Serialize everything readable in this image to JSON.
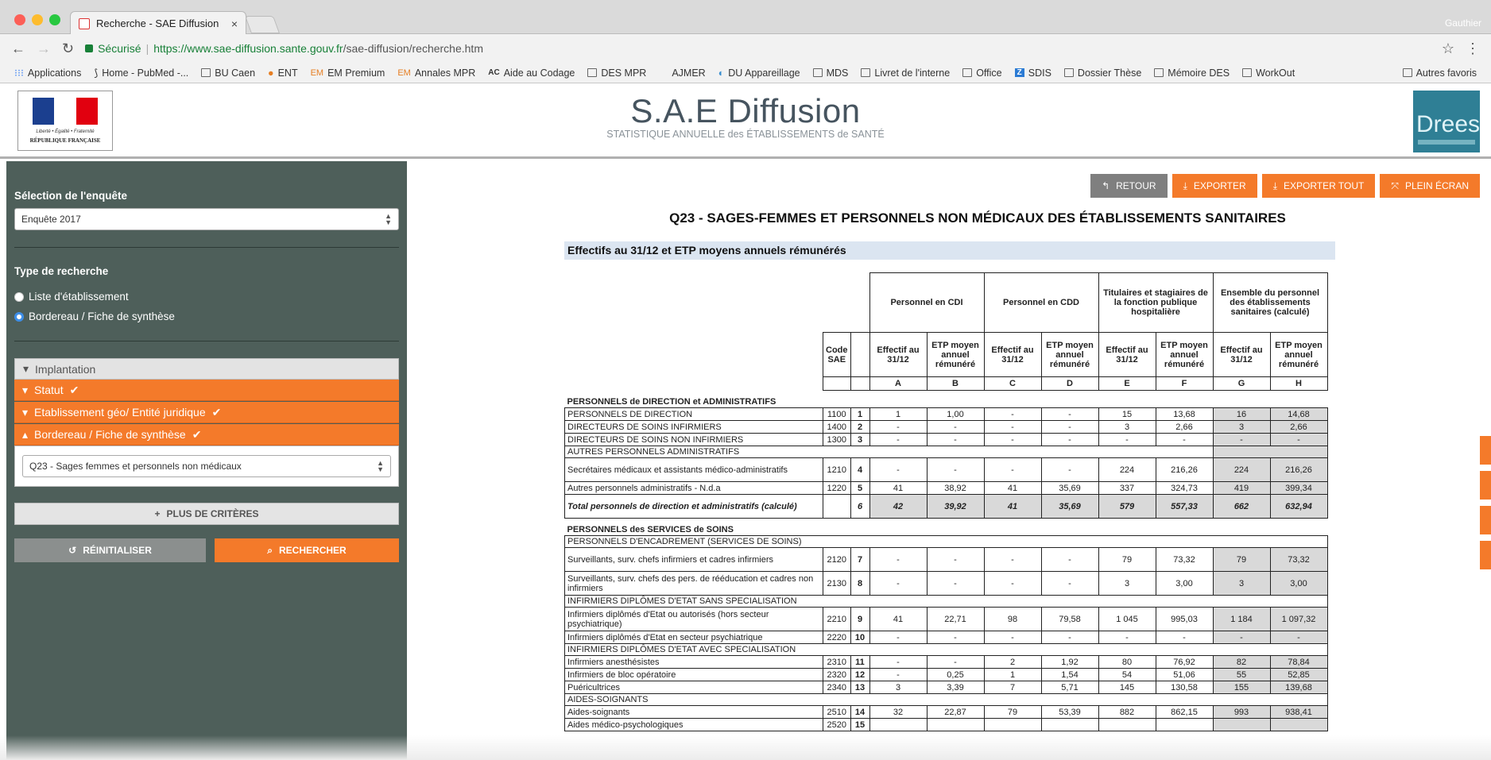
{
  "browser": {
    "tab_title": "Recherche - SAE Diffusion",
    "profile": "Gauthier",
    "secure_label": "Sécurisé",
    "url_host": "https://www.sae-diffusion.sante.gouv.fr",
    "url_path": "/sae-diffusion/recherche.htm",
    "bookmarks": [
      "Applications",
      "Home - PubMed -...",
      "BU Caen",
      "ENT",
      "EM Premium",
      "Annales MPR",
      "Aide au Codage",
      "DES MPR",
      "AJMER",
      "DU Appareillage",
      "MDS",
      "Livret de l'interne",
      "Office",
      "SDIS",
      "Dossier Thèse",
      "Mémoire DES",
      "WorkOut"
    ],
    "other_bookmarks": "Autres favoris"
  },
  "header": {
    "title": "S.A.E Diffusion",
    "subtitle": "STATISTIQUE ANNUELLE des ÉTABLISSEMENTS de SANTÉ",
    "republic_motto": "Liberté • Égalité • Fraternité",
    "republic_name": "RÉPUBLIQUE FRANÇAISE",
    "drees_logo": "Drees",
    "colors": {
      "brand_orange": "#f47a2a",
      "sidebar": "#4e5f5a"
    }
  },
  "sidebar": {
    "survey_label": "Sélection de l'enquête",
    "survey_value": "Enquête 2017",
    "search_type_label": "Type de recherche",
    "radio_1": "Liste d'établissement",
    "radio_2": "Bordereau / Fiche de synthèse",
    "acc_implantation": "Implantation",
    "acc_statut": "Statut",
    "acc_etab": "Etablissement géo/ Entité juridique",
    "acc_bordereau": "Bordereau / Fiche de synthèse",
    "bordereau_value": "Q23 - Sages femmes et personnels non médicaux",
    "more_criteria": "PLUS DE CRITÈRES",
    "reset": "RÉINITIALISER",
    "search": "RECHERCHER"
  },
  "main": {
    "btn_back": "RETOUR",
    "btn_export": "EXPORTER",
    "btn_export_all": "EXPORTER TOUT",
    "btn_fullscreen": "PLEIN ÉCRAN",
    "title": "Q23 - SAGES-FEMMES ET PERSONNELS NON MÉDICAUX DES ÉTABLISSEMENTS SANITAIRES",
    "section": "Effectifs au 31/12 et ETP moyens annuels rémunérés",
    "groups": {
      "cdi": "Personnel en CDI",
      "cdd": "Personnel en CDD",
      "tit": "Titulaires et stagiaires de la fonction publique hospitalière",
      "ens": "Ensemble du personnel des établissements sanitaires (calculé)"
    },
    "code_header": "Code SAE",
    "sub_eff": "Effectif au 31/12",
    "sub_etp": "ETP moyen annuel rémunéré",
    "letters": [
      "A",
      "B",
      "C",
      "D",
      "E",
      "F",
      "G",
      "H"
    ],
    "cat1": "PERSONNELS de DIRECTION et ADMINISTRATIFS",
    "cat2": "PERSONNELS des SERVICES de SOINS",
    "rows": [
      {
        "label": "PERSONNELS DE DIRECTION",
        "code": "1100",
        "num": "1",
        "v": [
          "1",
          "1,00",
          "-",
          "-",
          "15",
          "13,68",
          "16",
          "14,68"
        ]
      },
      {
        "label": "DIRECTEURS DE SOINS INFIRMIERS",
        "code": "1400",
        "num": "2",
        "v": [
          "-",
          "-",
          "-",
          "-",
          "3",
          "2,66",
          "3",
          "2,66"
        ]
      },
      {
        "label": "DIRECTEURS DE SOINS NON INFIRMIERS",
        "code": "1300",
        "num": "3",
        "v": [
          "-",
          "-",
          "-",
          "-",
          "-",
          "-",
          "-",
          "-"
        ]
      },
      {
        "label": "AUTRES PERSONNELS ADMINISTRATIFS"
      },
      {
        "label": "Secrétaires médicaux et assistants médico-administratifs",
        "code": "1210",
        "num": "4",
        "v": [
          "-",
          "-",
          "-",
          "-",
          "224",
          "216,26",
          "224",
          "216,26"
        ]
      },
      {
        "label": "Autres personnels administratifs - N.d.a",
        "code": "1220",
        "num": "5",
        "v": [
          "41",
          "38,92",
          "41",
          "35,69",
          "337",
          "324,73",
          "419",
          "399,34"
        ]
      },
      {
        "label": "Total personnels de direction et administratifs (calculé)",
        "num": "6",
        "v": [
          "42",
          "39,92",
          "41",
          "35,69",
          "579",
          "557,33",
          "662",
          "632,94"
        ]
      },
      {
        "label": "PERSONNELS D'ENCADREMENT (SERVICES DE SOINS)"
      },
      {
        "label": "Surveillants, surv. chefs infirmiers et cadres infirmiers",
        "code": "2120",
        "num": "7",
        "v": [
          "-",
          "-",
          "-",
          "-",
          "79",
          "73,32",
          "79",
          "73,32"
        ]
      },
      {
        "label": "Surveillants, surv. chefs des pers. de rééducation et cadres non infirmiers",
        "code": "2130",
        "num": "8",
        "v": [
          "-",
          "-",
          "-",
          "-",
          "3",
          "3,00",
          "3",
          "3,00"
        ]
      },
      {
        "label": "INFIRMIERS DIPLÔMES D'ETAT SANS SPECIALISATION"
      },
      {
        "label": "Infirmiers diplômés d'Etat ou autorisés (hors secteur psychiatrique)",
        "code": "2210",
        "num": "9",
        "v": [
          "41",
          "22,71",
          "98",
          "79,58",
          "1 045",
          "995,03",
          "1 184",
          "1 097,32"
        ]
      },
      {
        "label": "Infirmiers diplômés d'Etat en secteur psychiatrique",
        "code": "2220",
        "num": "10",
        "v": [
          "-",
          "-",
          "-",
          "-",
          "-",
          "-",
          "-",
          "-"
        ]
      },
      {
        "label": "INFIRMIERS DIPLÔMES D'ETAT AVEC SPECIALISATION"
      },
      {
        "label": "Infirmiers anesthésistes",
        "code": "2310",
        "num": "11",
        "v": [
          "-",
          "-",
          "2",
          "1,92",
          "80",
          "76,92",
          "82",
          "78,84"
        ]
      },
      {
        "label": "Infirmiers de bloc opératoire",
        "code": "2320",
        "num": "12",
        "v": [
          "-",
          "0,25",
          "1",
          "1,54",
          "54",
          "51,06",
          "55",
          "52,85"
        ]
      },
      {
        "label": "Puéricultrices",
        "code": "2340",
        "num": "13",
        "v": [
          "3",
          "3,39",
          "7",
          "5,71",
          "145",
          "130,58",
          "155",
          "139,68"
        ]
      },
      {
        "label": "AIDES-SOIGNANTS"
      },
      {
        "label": "Aides-soignants",
        "code": "2510",
        "num": "14",
        "v": [
          "32",
          "22,87",
          "79",
          "53,39",
          "882",
          "862,15",
          "993",
          "938,41"
        ]
      },
      {
        "label": "Aides médico-psychologiques",
        "code": "2520",
        "num": "15",
        "v": [
          "",
          "",
          "",
          "",
          "",
          "",
          "",
          ""
        ]
      }
    ]
  }
}
